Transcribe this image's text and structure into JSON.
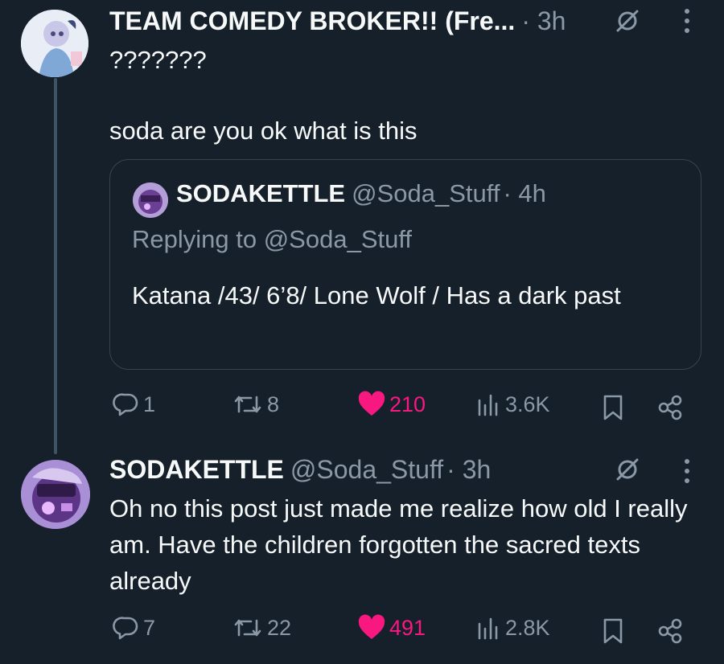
{
  "tweet1": {
    "display_name": "TEAM COMEDY BROKER!! (Fre...",
    "time": "· 3h",
    "line1": "???????",
    "body": "soda are you ok what is this",
    "icons": {
      "grok": "grok-icon",
      "more": "more-vertical-icon"
    },
    "quoted": {
      "display_name": "SODAKETTLE",
      "handle": "@Soda_Stuff",
      "time": "· 4h",
      "replying_to": "Replying to @Soda_Stuff",
      "body": "Katana /43/ 6’8/ Lone Wolf / Has a dark past"
    },
    "actions": {
      "replies": "1",
      "reposts": "8",
      "likes": "210",
      "views": "3.6K"
    }
  },
  "tweet2": {
    "display_name": "SODAKETTLE",
    "handle": "@Soda_Stuff",
    "time": "· 3h",
    "body": "Oh no this post just made me realize how old I really am. Have the children forgotten the sacred texts already",
    "actions": {
      "replies": "7",
      "reposts": "22",
      "likes": "491",
      "views": "2.8K"
    }
  },
  "colors": {
    "background": "#15202b",
    "text": "#f7f9f9",
    "muted": "#8b98a5",
    "like": "#f91880",
    "border": "#38444d"
  }
}
